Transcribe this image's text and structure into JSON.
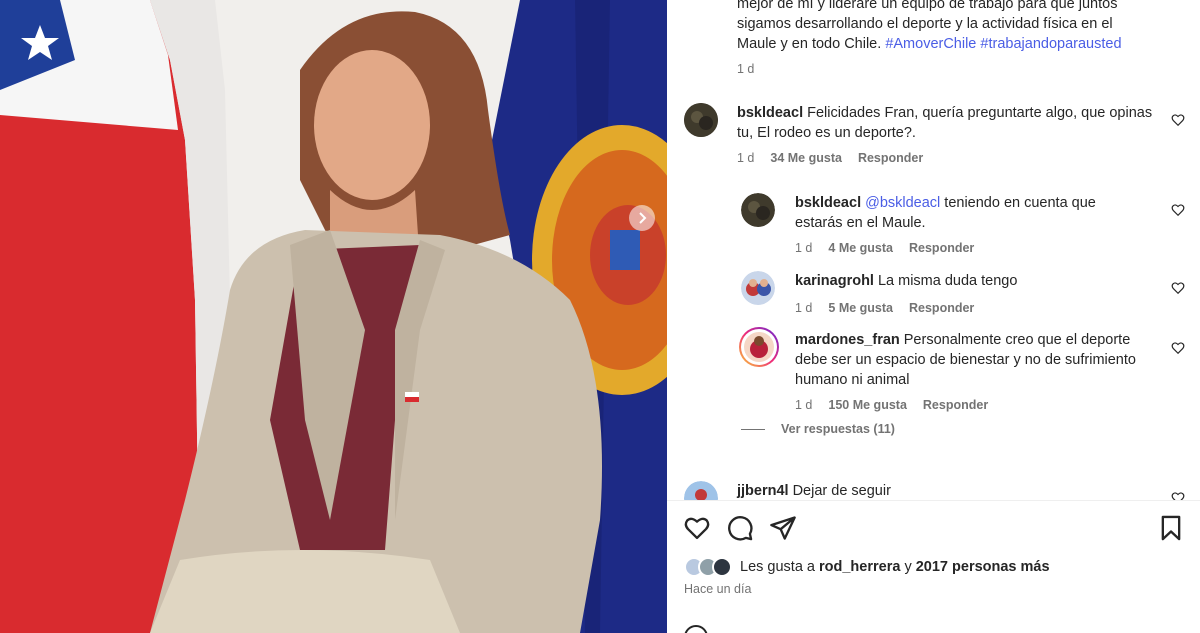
{
  "post": {
    "caption_lines": [
      "mejor de mí y lideraré un equipo de trabajo para que juntos",
      "sigamos desarrollando el deporte y la actividad física en el",
      "Maule y en todo Chile."
    ],
    "hashtags": [
      "#AmoverChile",
      "#trabajandoparausted"
    ],
    "caption_time": "1 d"
  },
  "comments": [
    {
      "username": "bskldeacl",
      "text": "Felicidades Fran, quería preguntarte algo, que opinas tu, El rodeo es un deporte?.",
      "time": "1 d",
      "likes": "34 Me gusta",
      "reply": "Responder"
    },
    {
      "username": "bskldeacl",
      "mention": "@bskldeacl",
      "text": "teniendo en cuenta que estarás en el Maule.",
      "time": "1 d",
      "likes": "4 Me gusta",
      "reply": "Responder"
    },
    {
      "username": "karinagrohl",
      "text": "La misma duda tengo",
      "time": "1 d",
      "likes": "5 Me gusta",
      "reply": "Responder"
    },
    {
      "username": "mardones_fran",
      "text": "Personalmente creo que el deporte debe ser un espacio de bienestar y no de sufrimiento humano ni animal",
      "time": "1 d",
      "likes": "150 Me gusta",
      "reply": "Responder"
    },
    {
      "username": "jjbern4l",
      "text": "Dejar de seguir"
    }
  ],
  "view_replies": "Ver respuestas (11)",
  "likes_summary": {
    "prefix": "Les gusta a",
    "user": "rod_herrera",
    "middle": "y",
    "others": "2017 personas más"
  },
  "time_ago": "Hace un día",
  "icons": {
    "like": "heart-icon",
    "comment": "comment-icon",
    "share": "share-icon",
    "save": "bookmark-icon",
    "next": "chevron-right-icon"
  },
  "colors": {
    "link": "#4a5de5",
    "secondary_text": "#737373",
    "primary_text": "#262626"
  }
}
